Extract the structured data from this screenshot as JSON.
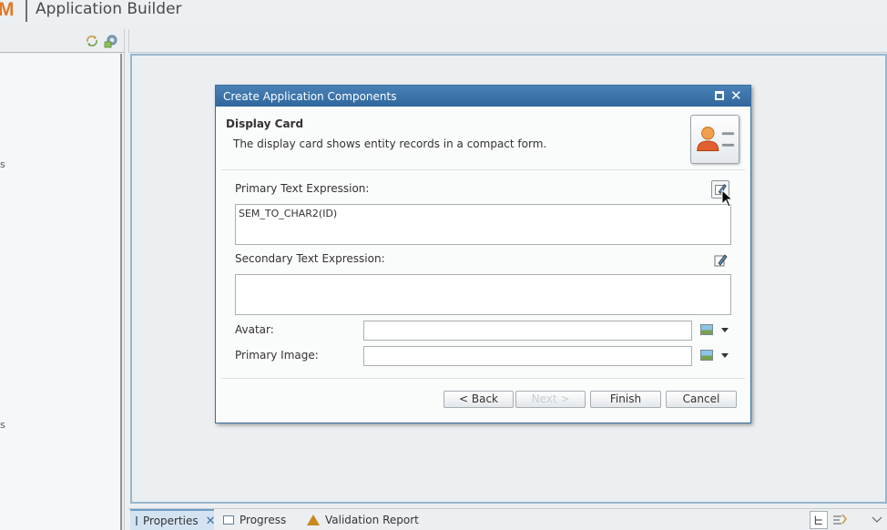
{
  "header": {
    "logo_text": "M",
    "title": "Application Builder"
  },
  "left_panel": {
    "toolbar_icons": [
      "sync-icon",
      "settings-gear-icon"
    ],
    "cut_labels": [
      "s",
      "s"
    ]
  },
  "bottom_tabs": {
    "tabs": [
      {
        "label": "Properties",
        "icon": "properties-icon",
        "active": true,
        "closable": true
      },
      {
        "label": "Progress",
        "icon": "progress-icon",
        "active": false
      },
      {
        "label": "Validation Report",
        "icon": "warning-icon",
        "active": false
      }
    ],
    "right_icons": [
      "layout-icon",
      "filter-icon",
      "view-menu-icon"
    ]
  },
  "dialog": {
    "title": "Create Application Components",
    "section_title": "Display Card",
    "section_desc": "The display card shows entity records in a compact form.",
    "primary_text_label": "Primary Text Expression:",
    "primary_text_value": "SEM_TO_CHAR2(ID)",
    "secondary_text_label": "Secondary Text Expression:",
    "secondary_text_value": "",
    "avatar_label": "Avatar:",
    "avatar_value": "",
    "primary_image_label": "Primary Image:",
    "primary_image_value": "",
    "buttons": {
      "back": "< Back",
      "next": "Next >",
      "finish": "Finish",
      "cancel": "Cancel"
    }
  },
  "colors": {
    "dialog_titlebar": "#3a72a8",
    "logo": "#e07a29",
    "active_tab": "#d3e3f1"
  }
}
